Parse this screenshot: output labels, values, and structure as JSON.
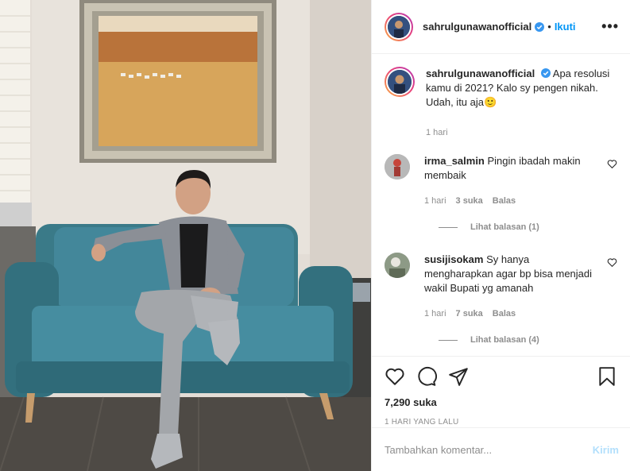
{
  "photo": {
    "alt_icon": "post-photo"
  },
  "header": {
    "username": "sahrulgunawanofficial",
    "separator": "•",
    "follow_label": "Ikuti",
    "more_label": "•••"
  },
  "caption": {
    "username": "sahrulgunawanofficial",
    "text": "Apa resolusi kamu di 2021? Kalo sy pengen nikah. Udah, itu aja",
    "emoji": "🙂",
    "time": "1 hari"
  },
  "comments": [
    {
      "username": "irma_salmin",
      "text": "Pingin ibadah makin membaik",
      "time": "1 hari",
      "likes": "3 suka",
      "reply_label": "Balas",
      "view_replies": "Lihat balasan (1)"
    },
    {
      "username": "susijisokam",
      "text": "Sy hanya mengharapkan agar bp bisa menjadi wakil Bupati yg amanah",
      "time": "1 hari",
      "likes": "7 suka",
      "reply_label": "Balas",
      "view_replies": "Lihat balasan (4)"
    }
  ],
  "actions": {
    "likes": "7,290 suka",
    "time_ago": "1 HARI YANG LALU"
  },
  "add_comment": {
    "placeholder": "Tambahkan komentar...",
    "post_label": "Kirim"
  },
  "colors": {
    "link": "#0095f6",
    "post_disabled": "#b2dffc",
    "muted": "#8e8e8e",
    "sofa": "#3f7f8d"
  }
}
